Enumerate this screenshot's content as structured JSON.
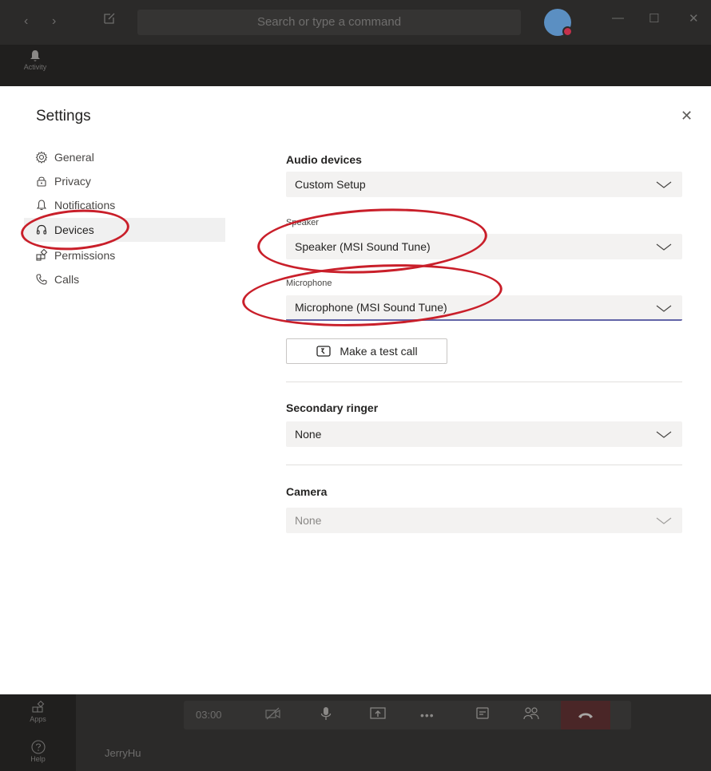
{
  "titlebar": {
    "search_placeholder": "Search or type a command"
  },
  "subbar": {
    "activity_label": "Activity"
  },
  "settings": {
    "title": "Settings",
    "sidebar": [
      {
        "label": "General",
        "icon": "gear-icon"
      },
      {
        "label": "Privacy",
        "icon": "lock-icon"
      },
      {
        "label": "Notifications",
        "icon": "bell-icon"
      },
      {
        "label": "Devices",
        "icon": "headset-icon",
        "active": true
      },
      {
        "label": "Permissions",
        "icon": "apps-icon"
      },
      {
        "label": "Calls",
        "icon": "phone-icon"
      }
    ],
    "audio": {
      "heading": "Audio devices",
      "value": "Custom Setup"
    },
    "speaker": {
      "label": "Speaker",
      "value": "Speaker (MSI Sound Tune)"
    },
    "microphone": {
      "label": "Microphone",
      "value": "Microphone (MSI Sound Tune)"
    },
    "test_call_label": "Make a test call",
    "secondary_ringer": {
      "heading": "Secondary ringer",
      "value": "None"
    },
    "camera": {
      "heading": "Camera",
      "value": "None"
    }
  },
  "call": {
    "timer": "03:00",
    "apps_label": "Apps",
    "help_label": "Help",
    "username": "JerryHu"
  },
  "colors": {
    "accent": "#6264a7",
    "annotation": "#c91f2a",
    "hangup": "#4a2627"
  }
}
